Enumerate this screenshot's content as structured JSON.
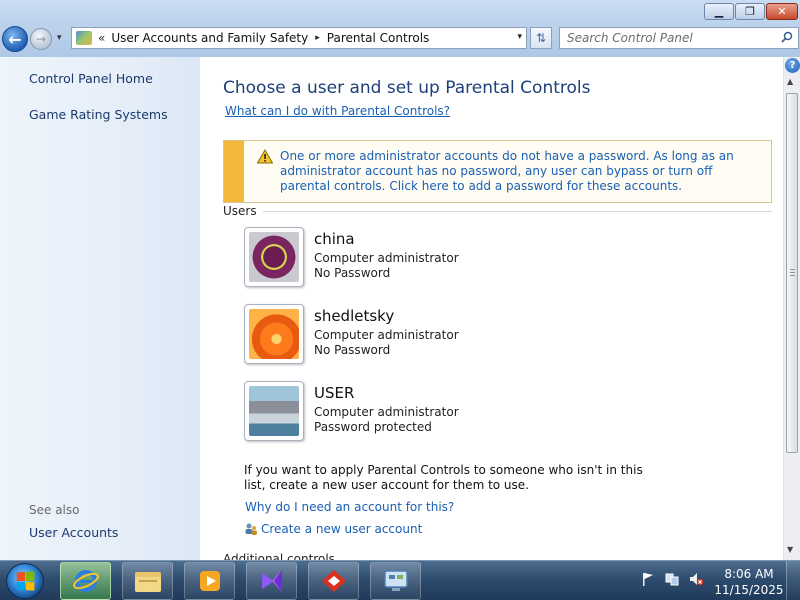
{
  "window": {
    "minimize": "▁",
    "maximize": "❐",
    "close": "✕"
  },
  "addressbar": {
    "chevron": "«",
    "segments": [
      "User Accounts and Family Safety",
      "Parental Controls"
    ],
    "separator": "▸",
    "dropdown": "▾"
  },
  "search": {
    "placeholder": "Search Control Panel"
  },
  "sidebar": {
    "items": [
      {
        "label": "Control Panel Home"
      },
      {
        "label": "Game Rating Systems"
      }
    ],
    "see_also_label": "See also",
    "see_also_items": [
      {
        "label": "User Accounts"
      }
    ]
  },
  "main": {
    "title": "Choose a user and set up Parental Controls",
    "help_link": "What can I do with Parental Controls?",
    "warning": "One or more administrator accounts do not have a password. As long as an administrator account has no password, any user can bypass or turn off parental controls. Click here to add a password for these accounts.",
    "users_heading": "Users",
    "users": [
      {
        "name": "china",
        "role": "Computer administrator",
        "password": "No Password"
      },
      {
        "name": "shedletsky",
        "role": "Computer administrator",
        "password": "No Password"
      },
      {
        "name": "USER",
        "role": "Computer administrator",
        "password": "Password protected"
      }
    ],
    "info_text": "If you want to apply Parental Controls to someone who isn't in this list, create a new user account for them to use.",
    "why_link": "Why do I need an account for this?",
    "create_link": "Create a new user account",
    "additional_heading": "Additional controls"
  },
  "taskbar": {
    "apps": [
      "internet-explorer",
      "file-explorer",
      "media-player",
      "visual-studio",
      "game-app",
      "control-panel"
    ],
    "clock_time": "8:06 AM",
    "clock_date": "11/15/2025"
  },
  "colors": {
    "link": "#1a5fb4",
    "title": "#1e3f7a",
    "warning_bar": "#f3b73a"
  }
}
